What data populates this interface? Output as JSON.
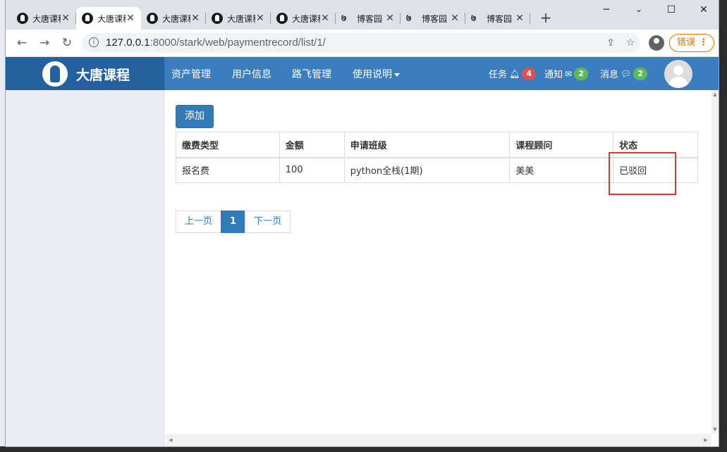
{
  "browser": {
    "tabs": [
      {
        "label": "大唐课程",
        "favicon": "datang-logo-icon",
        "active": false
      },
      {
        "label": "大唐课程",
        "favicon": "datang-logo-icon",
        "active": true
      },
      {
        "label": "大唐课程",
        "favicon": "datang-logo-icon",
        "active": false
      },
      {
        "label": "大唐课程",
        "favicon": "datang-logo-icon",
        "active": false
      },
      {
        "label": "大唐课程",
        "favicon": "datang-logo-icon",
        "active": false
      },
      {
        "label": "博客园",
        "favicon": "cnblogs-icon",
        "active": false
      },
      {
        "label": "博客园",
        "favicon": "cnblogs-icon",
        "active": false
      },
      {
        "label": "博客园",
        "favicon": "cnblogs-icon",
        "active": false
      }
    ],
    "new_tab": "+",
    "url_host": "127.0.0.1",
    "url_rest": ":8000/stark/web/paymentrecord/list/1/",
    "error_button": "错误"
  },
  "site": {
    "brand": "大唐课程",
    "menu": [
      {
        "label": "资产管理"
      },
      {
        "label": "用户信息"
      },
      {
        "label": "路飞管理"
      },
      {
        "label": "使用说明"
      }
    ],
    "right": [
      {
        "label": "任务",
        "icon": "bell-icon",
        "count": "4",
        "color": "#d9534f"
      },
      {
        "label": "通知",
        "icon": "envelope-icon",
        "count": "2",
        "color": "#5cb85c"
      },
      {
        "label": "消息",
        "icon": "comment-icon",
        "count": "2",
        "color": "#5cb85c"
      }
    ]
  },
  "page": {
    "add_button": "添加",
    "table": {
      "headers": [
        "缴费类型",
        "金额",
        "申请班级",
        "课程顾问",
        "状态"
      ],
      "rows": [
        [
          "报名费",
          "100",
          "python全栈(1期)",
          "美美",
          "已驳回"
        ]
      ]
    },
    "pagination": {
      "prev": "上一页",
      "current": "1",
      "next": "下一页"
    }
  },
  "colors": {
    "primary": "#337ab7",
    "navbar": "#3b7dbd",
    "brand_bg": "#245f9e",
    "highlight": "#e03434"
  }
}
